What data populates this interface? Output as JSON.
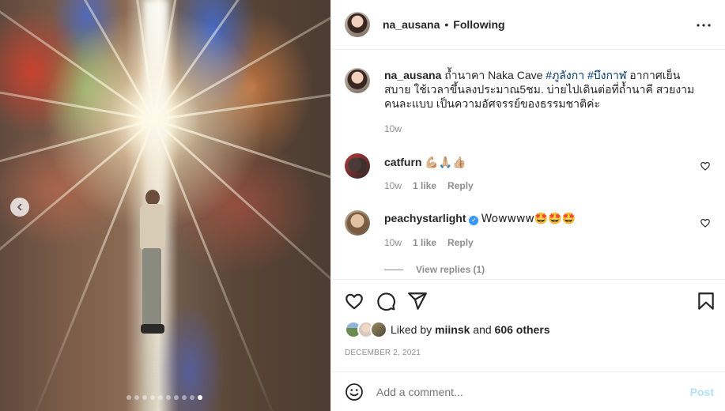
{
  "post": {
    "carousel": {
      "total_slides": 10,
      "active_slide": 10
    },
    "prev_icon": "chevron-left-icon"
  },
  "header": {
    "username": "na_ausana",
    "separator": "•",
    "following_label": "Following",
    "more_icon": "more-horizontal-icon"
  },
  "caption": {
    "username": "na_ausana",
    "text_before": "ถ้ำนาคา Naka Cave",
    "hashtags": [
      "#ภูลังกา",
      "#บึงกาฬ"
    ],
    "text_after": "อากาศเย็นสบาย ใช้เวลาขึ้นลงประมาณ5ชม. บ่ายไปเดินต่อที่ถ้ำนาคี สวยงามคนละแบบ เป็นความอัศจรรย์ของธรรมชาติค่ะ",
    "time": "10w"
  },
  "comments": [
    {
      "username": "catfurn",
      "text": "💪🏼🙏🏼👍🏼",
      "time": "10w",
      "likes": "1 like",
      "reply_label": "Reply",
      "verified": false
    },
    {
      "username": "peachystarlight",
      "text": "Wowwww🤩🤩🤩",
      "time": "10w",
      "likes": "1 like",
      "reply_label": "Reply",
      "verified": true
    }
  ],
  "view_replies": "View replies (1)",
  "likes": {
    "prefix": "Liked by",
    "first_user": "miinsk",
    "conjunction": "and",
    "others": "606 others"
  },
  "date": "DECEMBER 2, 2021",
  "add_comment": {
    "placeholder": "Add a comment...",
    "post_label": "Post"
  },
  "colors": {
    "hashtag": "#00376b",
    "post_disabled": "#b2dffc",
    "verified": "#3897f0",
    "muted": "#8e8e8e"
  }
}
